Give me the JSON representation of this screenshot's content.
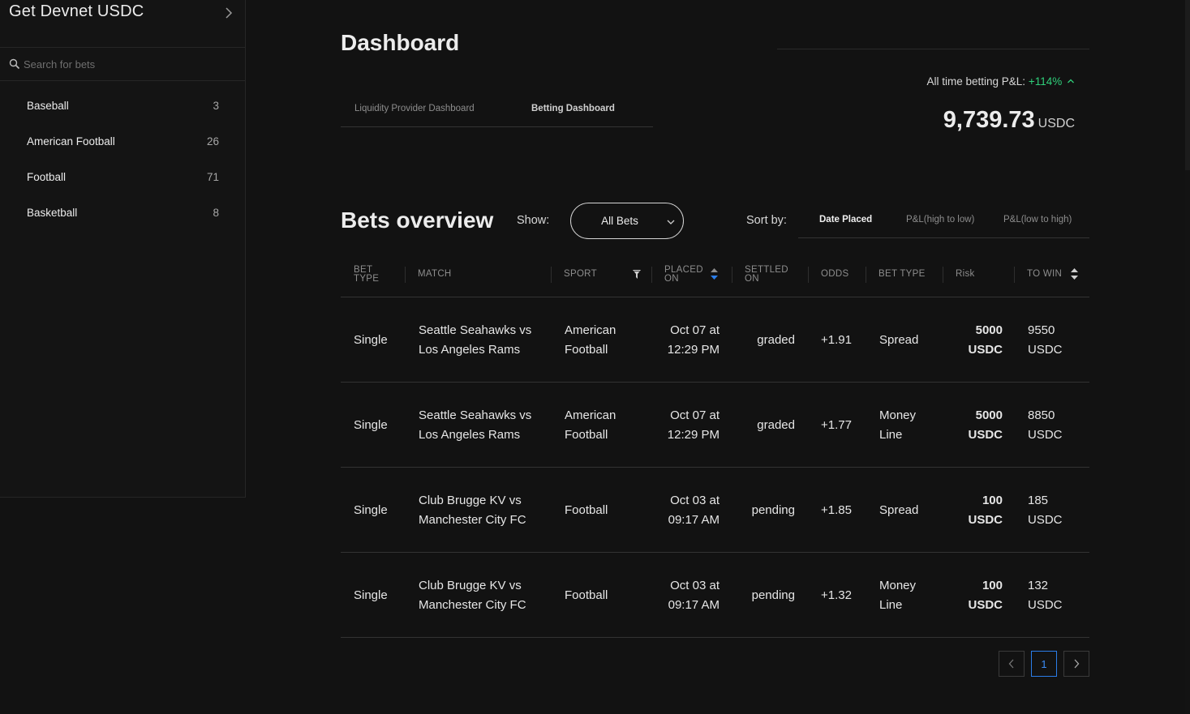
{
  "sidebar": {
    "title": "Get Devnet USDC",
    "search_placeholder": "Search for bets",
    "items": [
      {
        "label": "Baseball",
        "count": "3"
      },
      {
        "label": "American Football",
        "count": "26"
      },
      {
        "label": "Football",
        "count": "71"
      },
      {
        "label": "Basketball",
        "count": "8"
      }
    ]
  },
  "dashboard": {
    "title": "Dashboard",
    "tabs": [
      "Liquidity Provider Dashboard",
      "Betting Dashboard"
    ],
    "active_tab": "Betting Dashboard",
    "pnl_label": "All time betting P&L:",
    "pnl_value": "+114%",
    "balance": "9,739.73",
    "balance_unit": "USDC"
  },
  "bets": {
    "title": "Bets overview",
    "show_label": "Show:",
    "show_value": "All Bets",
    "sort_label": "Sort by:",
    "sort_options": [
      "Date Placed",
      "P&L(high to low)",
      "P&L(low to high)"
    ],
    "active_sort": "Date Placed",
    "columns": {
      "bet_type": "BET TYPE",
      "match": "MATCH",
      "sport": "SPORT",
      "placed_on": "PLACED ON",
      "settled_on": "SETTLED ON",
      "odds": "ODDS",
      "bet_type2": "BET TYPE",
      "risk": "Risk",
      "to_win": "TO WIN"
    },
    "rows": [
      {
        "type": "Single",
        "match": "Seattle Seahawks vs Los Angeles Rams",
        "sport": "American Football",
        "placed": "Oct 07 at 12:29 PM",
        "settled": "graded",
        "odds": "+1.91",
        "bet_type": "Spread",
        "risk": "5000 USDC",
        "to_win": "9550 USDC"
      },
      {
        "type": "Single",
        "match": "Seattle Seahawks vs Los Angeles Rams",
        "sport": "American Football",
        "placed": "Oct 07 at 12:29 PM",
        "settled": "graded",
        "odds": "+1.77",
        "bet_type": "Money Line",
        "risk": "5000 USDC",
        "to_win": "8850 USDC"
      },
      {
        "type": "Single",
        "match": "Club Brugge KV vs Manchester City FC",
        "sport": "Football",
        "placed": "Oct 03 at 09:17 AM",
        "settled": "pending",
        "odds": "+1.85",
        "bet_type": "Spread",
        "risk": "100 USDC",
        "to_win": "185 USDC"
      },
      {
        "type": "Single",
        "match": "Club Brugge KV vs Manchester City FC",
        "sport": "Football",
        "placed": "Oct 03 at 09:17 AM",
        "settled": "pending",
        "odds": "+1.32",
        "bet_type": "Money Line",
        "risk": "100 USDC",
        "to_win": "132 USDC"
      }
    ],
    "current_page": "1"
  },
  "colors": {
    "background": "#121212",
    "positive": "#2fcf7a",
    "accent": "#2b7de9"
  }
}
